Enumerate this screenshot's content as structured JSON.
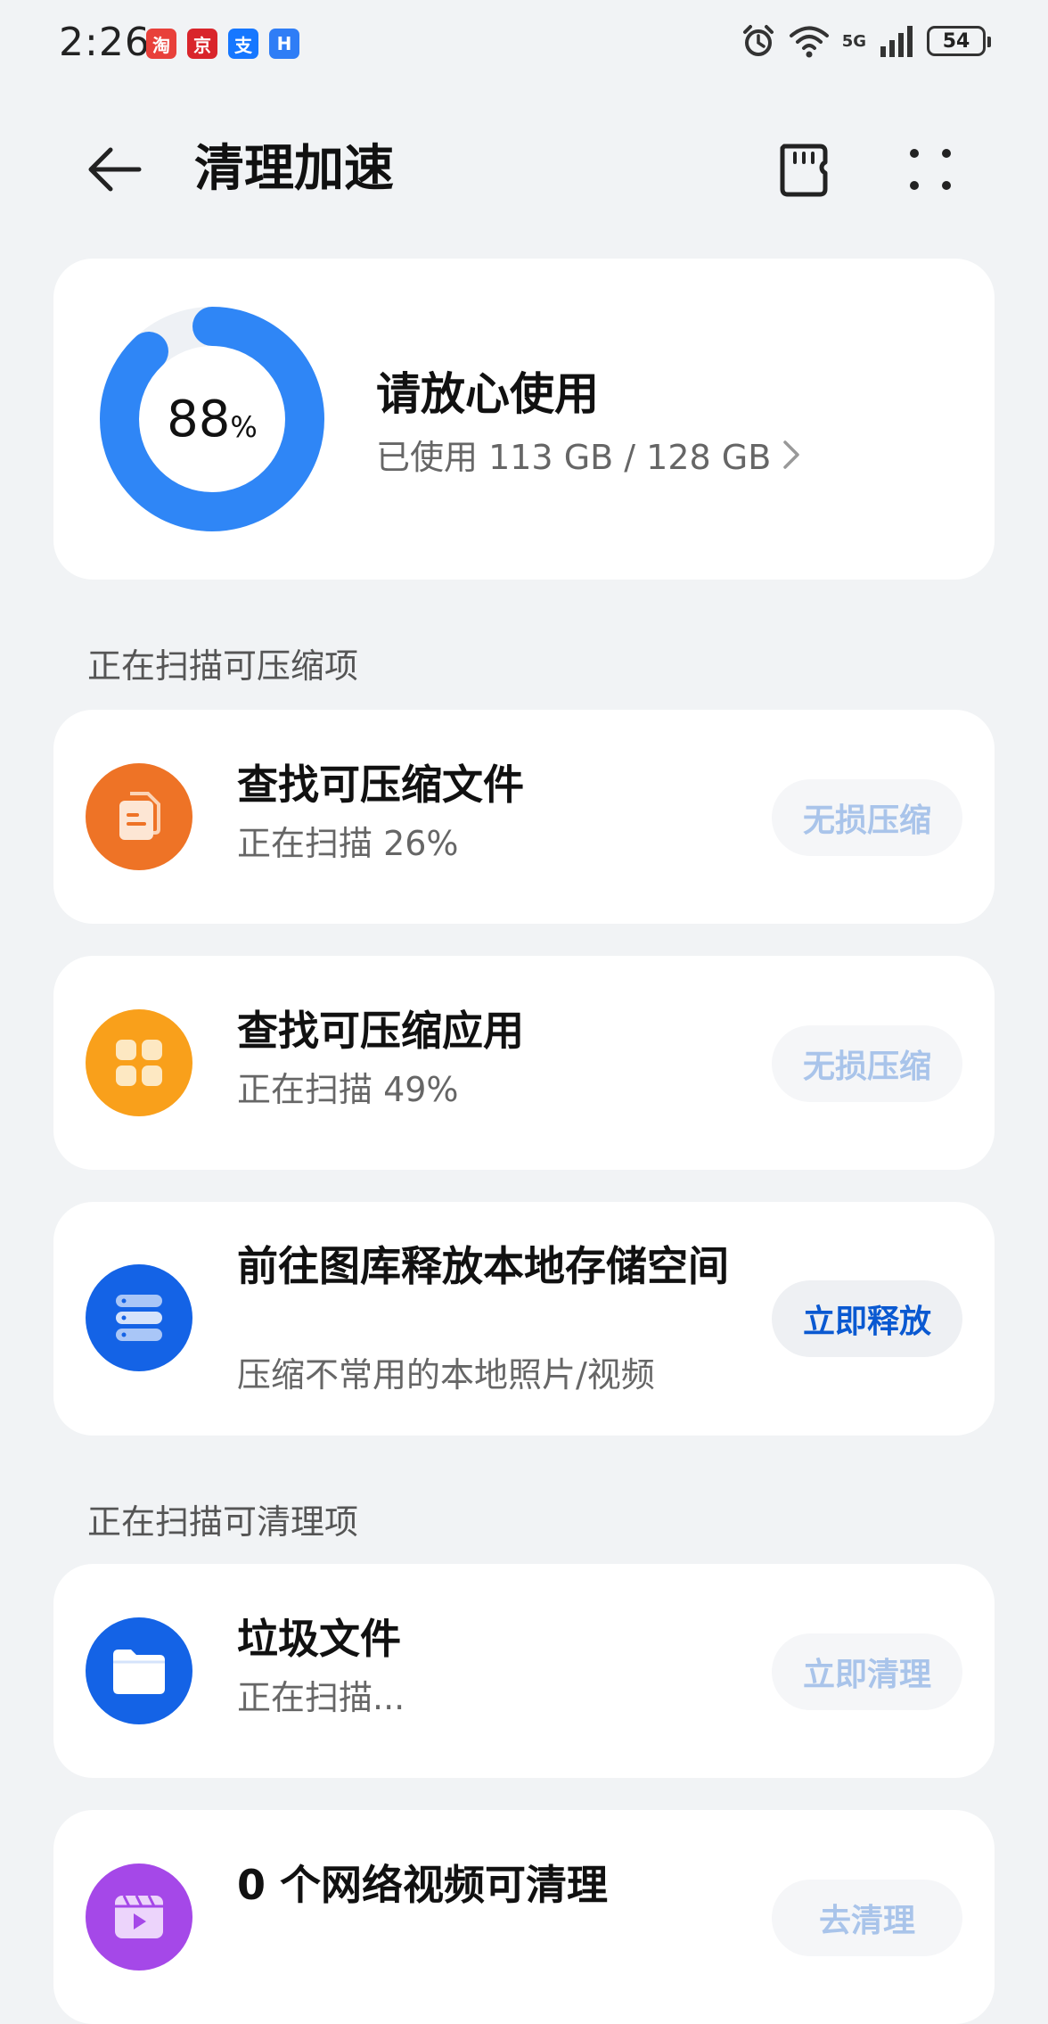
{
  "status_bar": {
    "time": "2:26",
    "notifications": [
      {
        "name": "taobao-app-icon",
        "glyph": "淘",
        "color": "#e8403a"
      },
      {
        "name": "jd-app-icon",
        "glyph": "京",
        "color": "#d9252b"
      },
      {
        "name": "alipay-app-icon",
        "glyph": "支",
        "color": "#1677ff"
      },
      {
        "name": "app-notification-icon",
        "glyph": "H",
        "color": "#2f7df6"
      }
    ],
    "network": "5G",
    "battery": "54"
  },
  "header": {
    "title": "清理加速"
  },
  "storage": {
    "percent": "88",
    "percent_unit": "%",
    "percent_value": 88,
    "status": "请放心使用",
    "detail": "已使用 113 GB / 128 GB",
    "ring_color": "#2f86f6",
    "track_color": "#eef1f5"
  },
  "sections": {
    "compress_title": "正在扫描可压缩项",
    "clean_title": "正在扫描可清理项"
  },
  "items": [
    {
      "title": "查找可压缩文件",
      "subtitle": "正在扫描 26%",
      "action": "无损压缩",
      "icon": "document-icon",
      "color": "#ee7326"
    },
    {
      "title": "查找可压缩应用",
      "subtitle": "正在扫描 49%",
      "action": "无损压缩",
      "icon": "apps-grid-icon",
      "color": "#f9a01b"
    },
    {
      "title": "前往图库释放本地存储空间",
      "subtitle": "压缩不常用的本地照片/视频",
      "action": "立即释放",
      "icon": "storage-stack-icon",
      "color": "#1463e6"
    },
    {
      "title": "垃圾文件",
      "subtitle": "正在扫描...",
      "action": "立即清理",
      "icon": "folder-icon",
      "color": "#1463e6"
    },
    {
      "title": "0 个网络视频可清理",
      "subtitle": "",
      "action": "去清理",
      "icon": "video-icon",
      "color": "#a548e8"
    }
  ]
}
